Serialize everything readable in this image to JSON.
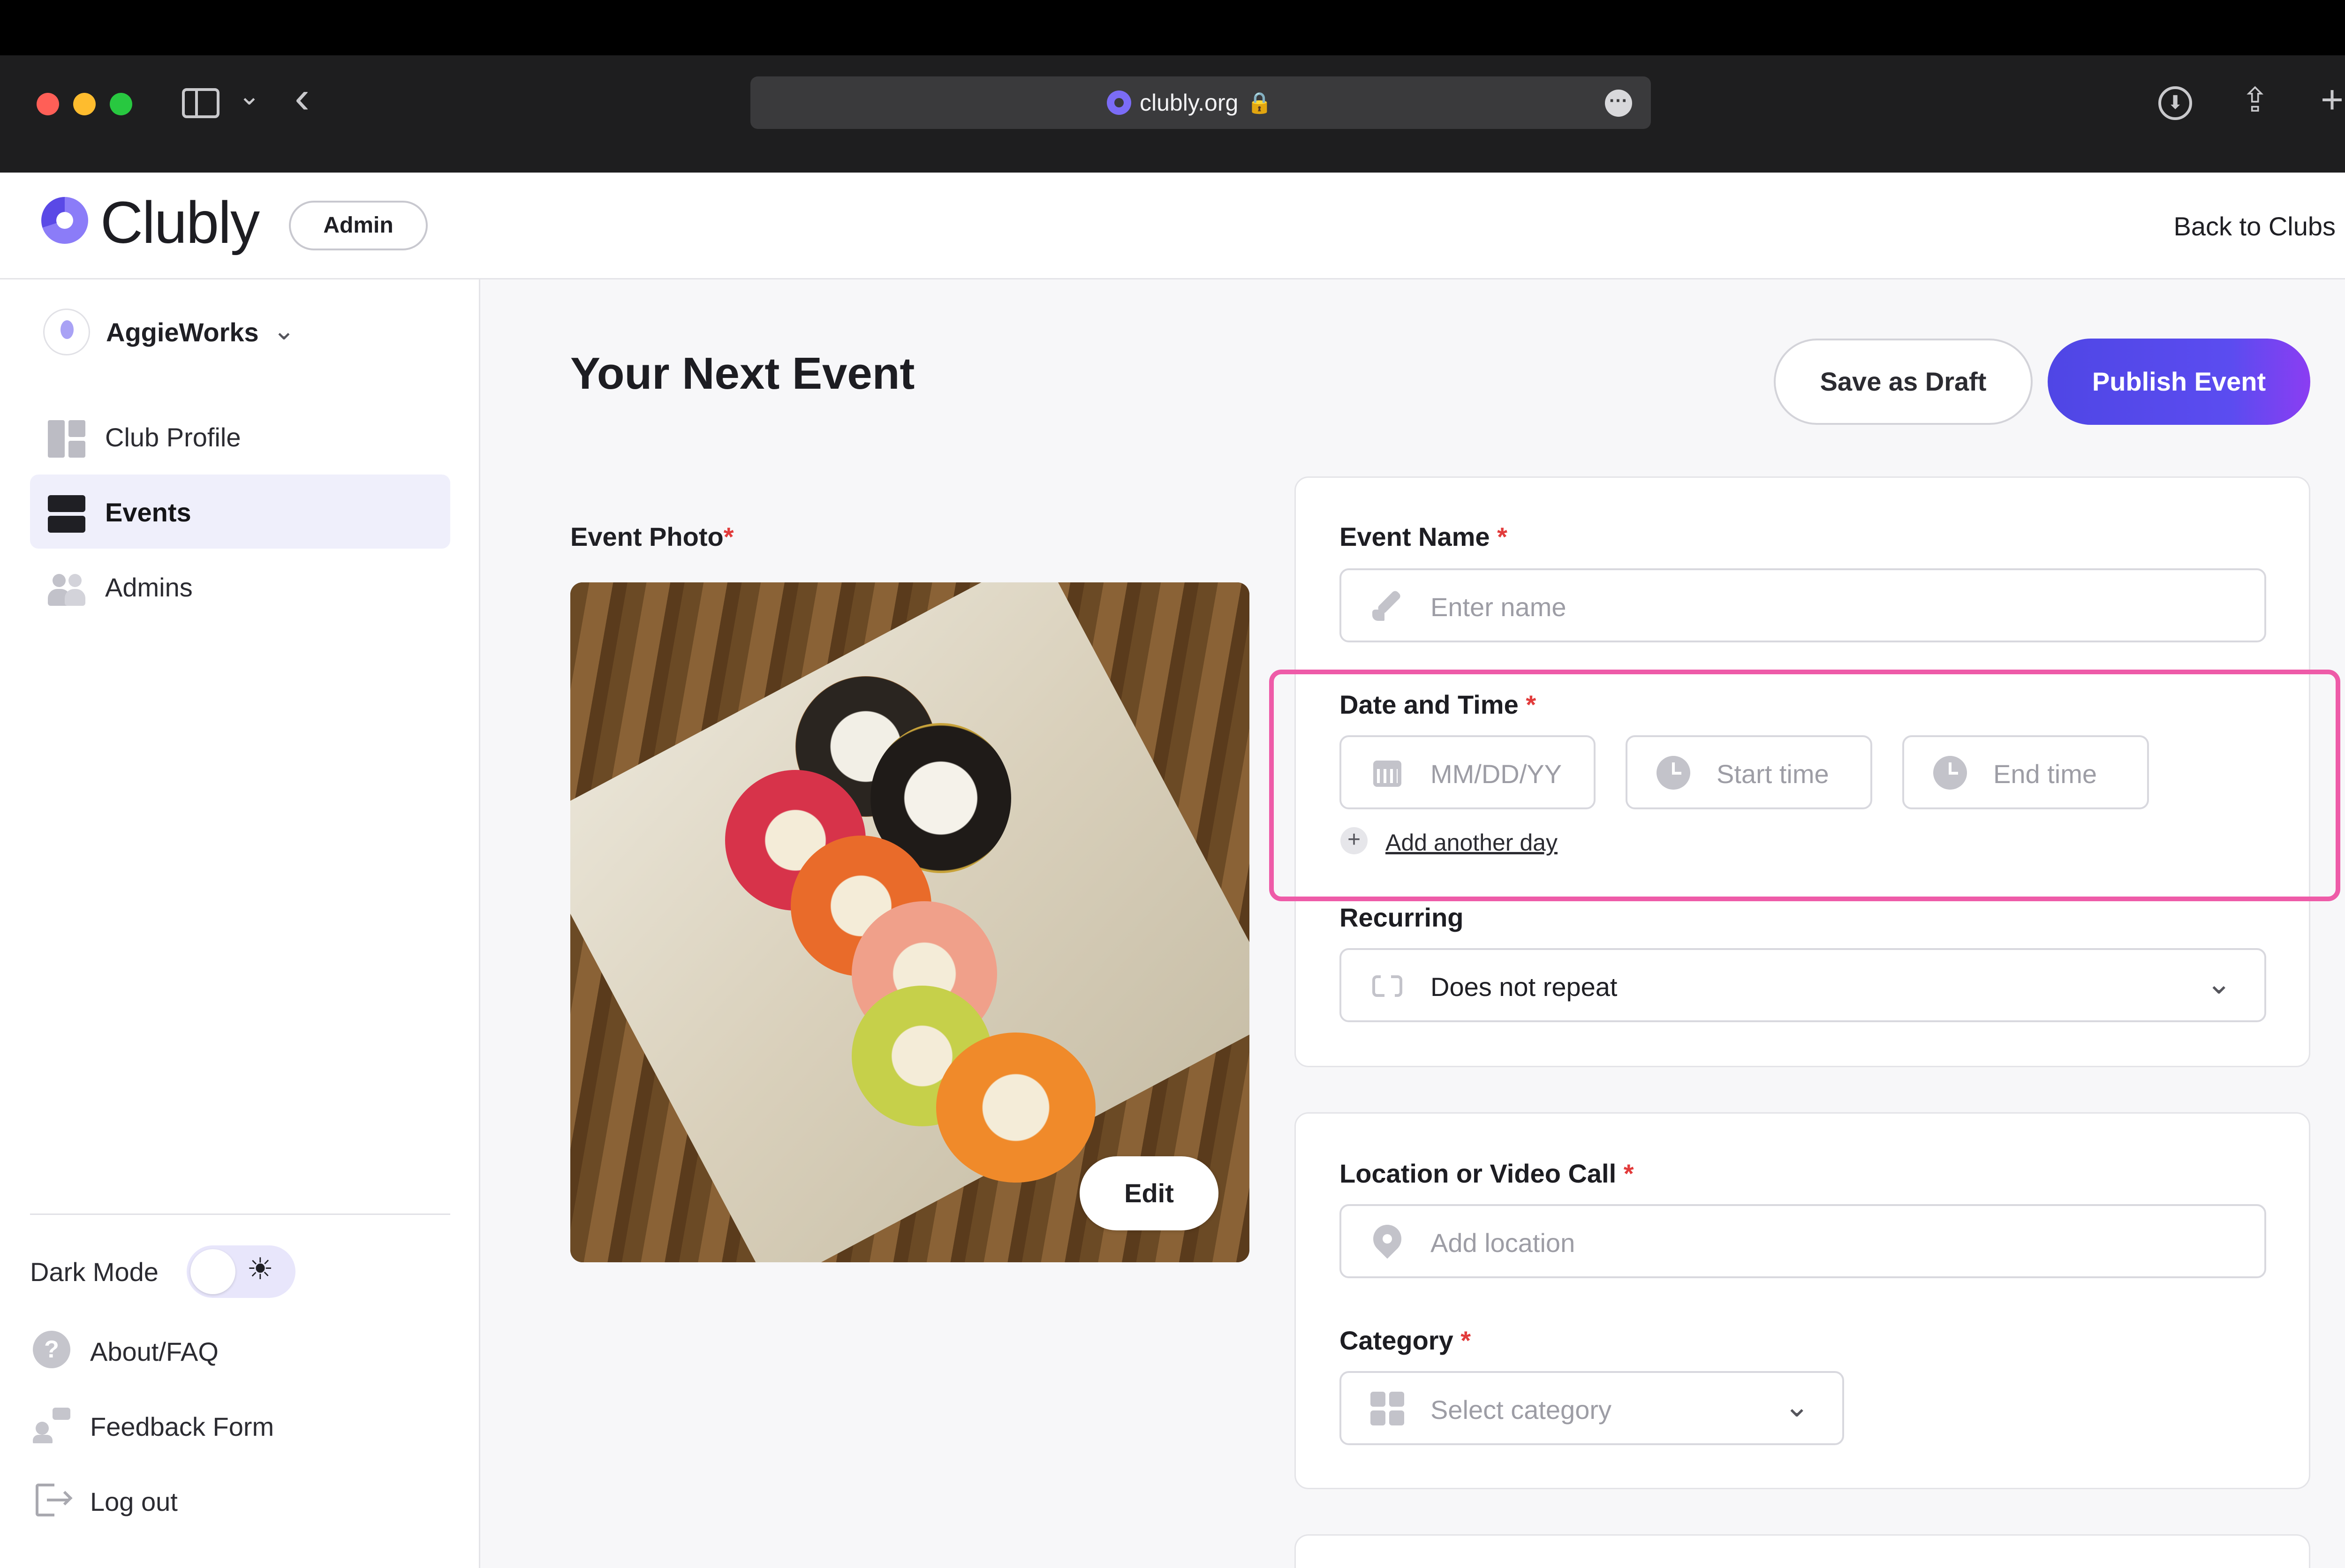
{
  "browser": {
    "url": "clubly.org",
    "lock_glyph": "🔒",
    "more_glyph": "···",
    "sidebar_icon": "sidebar-toggle-icon",
    "chevron_icon": "⌄",
    "back_glyph": "‹",
    "download_glyph": "⬇",
    "share_glyph": "⇪",
    "newtab_glyph": "+"
  },
  "header": {
    "logo_text": "Clubly",
    "role_badge": "Admin",
    "back_link": "Back to Clubs"
  },
  "sidebar": {
    "club_name": "AggieWorks",
    "club_chevron": "⌄",
    "nav": [
      {
        "label": "Club Profile",
        "icon": "layout-icon",
        "active": false
      },
      {
        "label": "Events",
        "icon": "events-icon",
        "active": true
      },
      {
        "label": "Admins",
        "icon": "users-icon",
        "active": false
      }
    ],
    "dark_mode_label": "Dark Mode",
    "dark_mode_on": false,
    "sun_glyph": "☀",
    "links": [
      {
        "label": "About/FAQ",
        "icon": "help-icon"
      },
      {
        "label": "Feedback Form",
        "icon": "feedback-icon"
      },
      {
        "label": "Log out",
        "icon": "logout-icon"
      }
    ]
  },
  "main": {
    "title": "Your Next Event",
    "save_draft": "Save as Draft",
    "publish": "Publish Event",
    "photo_label": "Event Photo",
    "required_mark": "*",
    "edit_button": "Edit",
    "form": {
      "event_name_label": "Event Name",
      "event_name_placeholder": "Enter name",
      "date_time_label": "Date and Time",
      "date_placeholder": "MM/DD/YY",
      "start_placeholder": "Start time",
      "end_placeholder": "End time",
      "add_day": "Add another day",
      "add_glyph": "+",
      "recurring_label": "Recurring",
      "recurring_value": "Does not repeat",
      "location_label": "Location or Video Call",
      "location_placeholder": "Add location",
      "category_label": "Category",
      "category_placeholder": "Select category",
      "dropdown_glyph": "⌄"
    }
  },
  "colors": {
    "accent": "#4f46e5",
    "highlight": "#ee5ba8",
    "required": "#e23b3b"
  }
}
